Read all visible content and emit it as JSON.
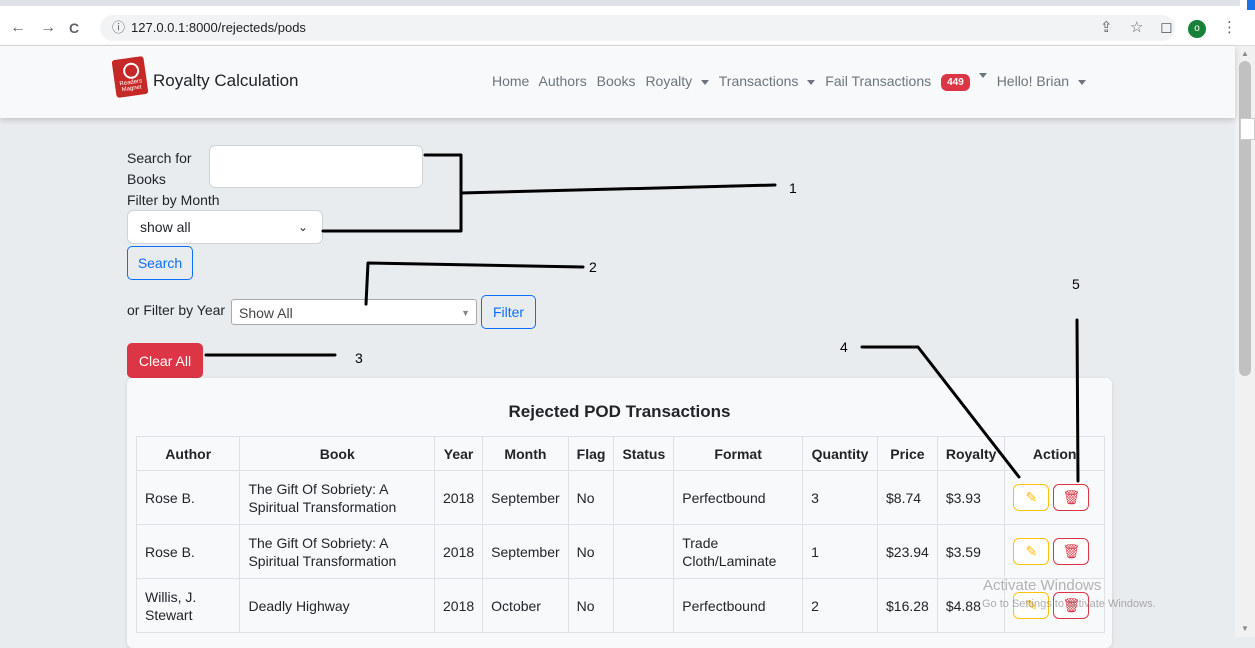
{
  "browser": {
    "back": "←",
    "forward": "→",
    "reload": "C",
    "url": "127.0.0.1:8000/rejecteds/pods",
    "profile_initial": "o"
  },
  "navbar": {
    "brand": "Royalty Calculation",
    "logo_text": "Readers Magnet",
    "links": {
      "home": "Home",
      "authors": "Authors",
      "books": "Books",
      "royalty": "Royalty",
      "transactions": "Transactions",
      "fail_transactions": "Fail Transactions",
      "fail_count": "449",
      "user": "Hello! Brian"
    }
  },
  "filters": {
    "search_label_1": "Search for",
    "search_label_2": "Books",
    "month_label": "Filter by Month",
    "month_value": "show all",
    "search_button": "Search",
    "year_label": "or Filter by Year",
    "year_value": "Show All",
    "filter_button": "Filter",
    "clear_button": "Clear All"
  },
  "table": {
    "title": "Rejected POD Transactions",
    "columns": [
      "Author",
      "Book",
      "Year",
      "Month",
      "Flag",
      "Status",
      "Format",
      "Quantity",
      "Price",
      "Royalty",
      "Action"
    ],
    "rows": [
      [
        "Rose B.",
        "The Gift Of Sobriety: A Spiritual Transformation",
        "2018",
        "September",
        "No",
        "",
        "Perfectbound",
        "3",
        "$8.74",
        "$3.93"
      ],
      [
        "Rose B.",
        "The Gift Of Sobriety: A Spiritual Transformation",
        "2018",
        "September",
        "No",
        "",
        "Trade Cloth/Laminate",
        "1",
        "$23.94",
        "$3.59"
      ],
      [
        "Willis, J. Stewart",
        "Deadly Highway",
        "2018",
        "October",
        "No",
        "",
        "Perfectbound",
        "2",
        "$16.28",
        "$4.88"
      ]
    ]
  },
  "annotations": {
    "n1": "1",
    "n2": "2",
    "n3": "3",
    "n4": "4",
    "n5": "5"
  },
  "watermark": {
    "title": "Activate Windows",
    "subtitle": "Go to Settings to activate Windows."
  }
}
